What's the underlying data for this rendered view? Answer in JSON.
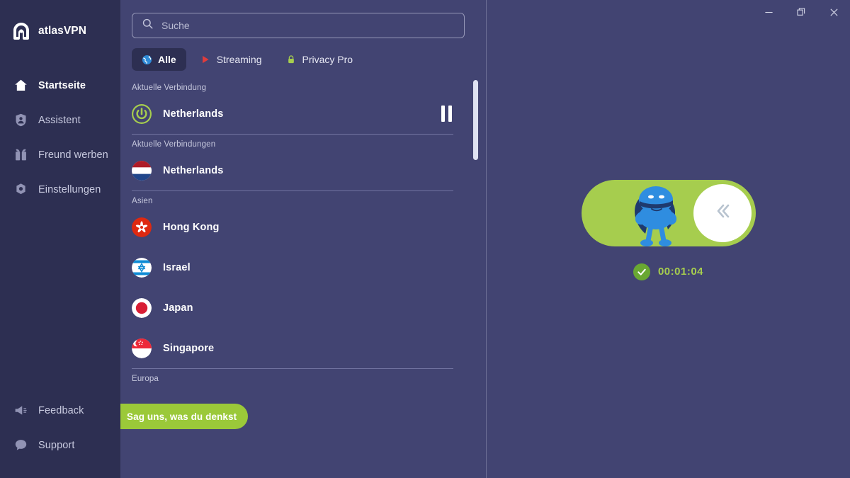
{
  "app": {
    "brand": "atlasVPN",
    "accent_green": "#a6cd4e",
    "sidebar_bg": "#2d2f52",
    "panel_bg": "#424472"
  },
  "sidebar": {
    "top_items": [
      {
        "label": "Startseite",
        "icon": "home-icon",
        "active": true
      },
      {
        "label": "Assistent",
        "icon": "shield-user-icon",
        "active": false
      },
      {
        "label": "Freund werben",
        "icon": "gift-icon",
        "active": false
      },
      {
        "label": "Einstellungen",
        "icon": "gear-icon",
        "active": false
      }
    ],
    "bottom_items": [
      {
        "label": "Feedback",
        "icon": "megaphone-icon",
        "active": false
      },
      {
        "label": "Support",
        "icon": "chat-bubble-icon",
        "active": false
      }
    ]
  },
  "search": {
    "placeholder": "Suche",
    "value": "",
    "icon": "search-icon"
  },
  "tabs": [
    {
      "label": "Alle",
      "icon": "globe-icon",
      "active": true
    },
    {
      "label": "Streaming",
      "icon": "play-icon",
      "active": false
    },
    {
      "label": "Privacy Pro",
      "icon": "lock-icon",
      "active": false
    }
  ],
  "groups": [
    {
      "label": "Aktuelle Verbindung",
      "rows": [
        {
          "name": "Netherlands",
          "icon": "power-icon",
          "trailing": "pause-icon"
        }
      ]
    },
    {
      "label": "Aktuelle Verbindungen",
      "rows": [
        {
          "name": "Netherlands",
          "icon": "flag-nl"
        }
      ]
    },
    {
      "label": "Asien",
      "rows": [
        {
          "name": "Hong Kong",
          "icon": "flag-hk"
        },
        {
          "name": "Israel",
          "icon": "flag-il"
        },
        {
          "name": "Japan",
          "icon": "flag-jp"
        },
        {
          "name": "Singapore",
          "icon": "flag-sg"
        }
      ]
    },
    {
      "label": "Europa",
      "rows": []
    }
  ],
  "feedback_pill": {
    "label": "Sag uns, was du denkst"
  },
  "connection": {
    "toggle_state": "on",
    "knob_icon": "chevrons-left-icon",
    "mascot": "superhero-mascot",
    "status_icon": "check-circle-icon",
    "timer": "00:01:04"
  },
  "window_controls": {
    "minimize": "minimize-icon",
    "restore": "restore-icon",
    "close": "close-icon"
  }
}
